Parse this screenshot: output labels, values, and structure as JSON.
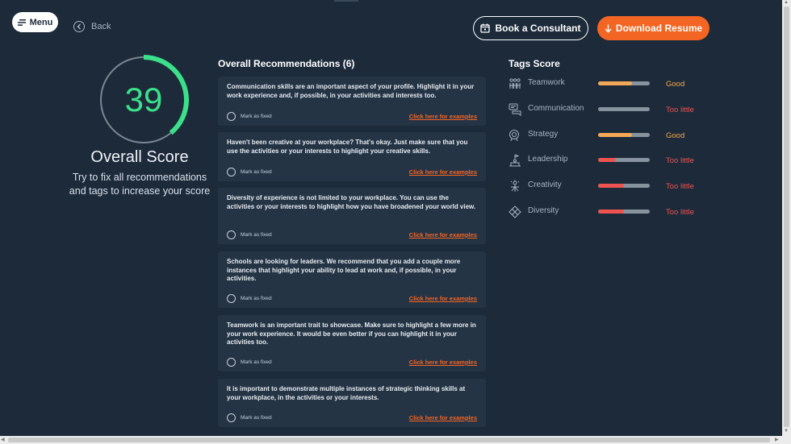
{
  "header": {
    "menu_label": "Menu",
    "back_label": "Back",
    "consult_label": "Book a Consultant",
    "download_label": "Download Resume"
  },
  "score": {
    "value": "39",
    "fraction": 0.39,
    "title": "Overall Score",
    "subtitle_line1": "Try to fix all recommendations",
    "subtitle_line2": "and tags to increase your score",
    "color": "#3be08a"
  },
  "recommendations": {
    "heading": "Overall Recommendations (6)",
    "mark_label": "Mark as fixed",
    "link_label": "Click here for examples",
    "items": [
      {
        "text": "Communication skills are an important aspect of your profile. Highlight it in your work experience and, if possible, in your activities and interests too."
      },
      {
        "text": "Haven't been creative at your workplace? That's okay. Just make sure that you use the activities or your interests to highlight your creative skills."
      },
      {
        "text": "Diversity of experience is not limited to your workplace. You can use the activities or your interests to highlight how you have broadened your world view."
      },
      {
        "text": "Schools are looking for leaders. We recommend that you add a couple more instances that highlight your ability to lead at work and, if possible, in your activities."
      },
      {
        "text": "Teamwork is an important trait to showcase. Make sure to highlight a few more in your work experience. It would be even better if you can highlight it in your activities too."
      },
      {
        "text": "It is important to demonstrate multiple instances of strategic thinking skills at your workplace, in the activities or your interests."
      }
    ]
  },
  "tags": {
    "heading": "Tags Score",
    "items": [
      {
        "name": "Teamwork",
        "icon": "team-icon",
        "level": 0.65,
        "status": "Good",
        "color": "#f2a857"
      },
      {
        "name": "Communication",
        "icon": "chat-icon",
        "level": 0.0,
        "status": "Too little",
        "color": "#ef5350"
      },
      {
        "name": "Strategy",
        "icon": "strategy-icon",
        "level": 0.65,
        "status": "Good",
        "color": "#f2a857"
      },
      {
        "name": "Leadership",
        "icon": "leadership-icon",
        "level": 0.35,
        "status": "Too little",
        "color": "#ef5350"
      },
      {
        "name": "Creativity",
        "icon": "creativity-icon",
        "level": 0.5,
        "status": "Too little",
        "color": "#ef5350"
      },
      {
        "name": "Diversity",
        "icon": "diversity-icon",
        "level": 0.5,
        "status": "Too little",
        "color": "#ef5350"
      }
    ]
  },
  "colors": {
    "background": "#1c2a3a",
    "card": "#253445",
    "accent": "#f36523",
    "good_text": "#f7a84a",
    "bad_text": "#ef5350"
  }
}
